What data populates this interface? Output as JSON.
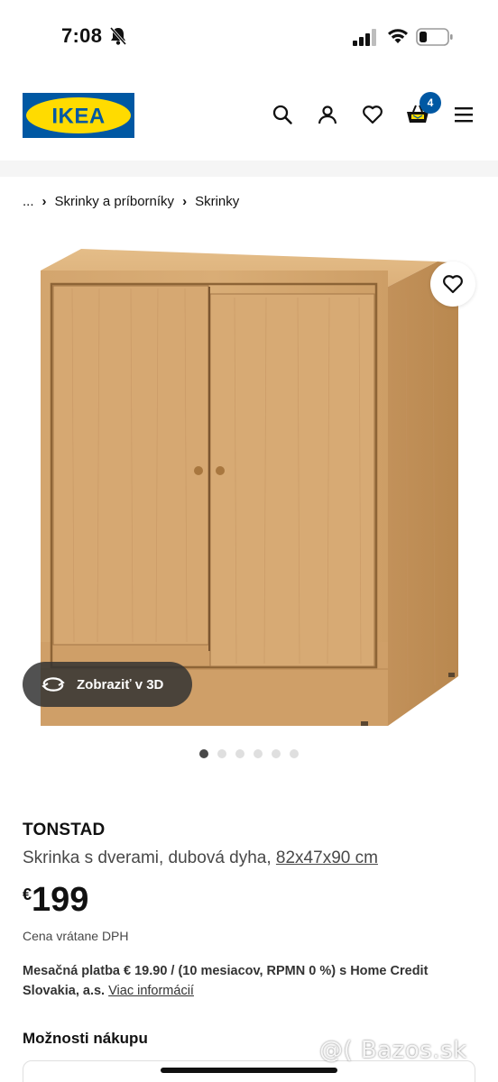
{
  "status_bar": {
    "time": "7:08",
    "battery_icon": "battery-low-icon",
    "wifi_icon": "wifi-icon",
    "signal_icon": "signal-icon",
    "silent_icon": "bell-slash-icon"
  },
  "header": {
    "logo_text": "IKEA",
    "icons": [
      "search-icon",
      "user-icon",
      "heart-icon",
      "basket-icon",
      "menu-icon"
    ],
    "basket_count": "4",
    "colors": {
      "logo_blue": "#0058a3",
      "logo_yellow": "#ffdb00",
      "badge": "#0058a3"
    }
  },
  "breadcrumb": {
    "ellipsis": "...",
    "items": [
      "Skrinky a príborníky",
      "Skrinky"
    ]
  },
  "gallery": {
    "view_3d_label": "Zobraziť v 3D",
    "dot_count": 6,
    "active_index": 0
  },
  "product": {
    "name": "TONSTAD",
    "description": "Skrinka s dverami, dubová dyha,",
    "dimensions": "82x47x90 cm",
    "currency": "€",
    "price": "199",
    "vat_note": "Cena vrátane DPH",
    "monthly": "Mesačná platba € 19.90 / (10 mesiacov, RPMN 0 %) s Home Credit Slovakia, a.s.",
    "more_info": "Viac informácií"
  },
  "purchase": {
    "title": "Možnosti nákupu"
  },
  "watermark": "@( Bazos.sk"
}
